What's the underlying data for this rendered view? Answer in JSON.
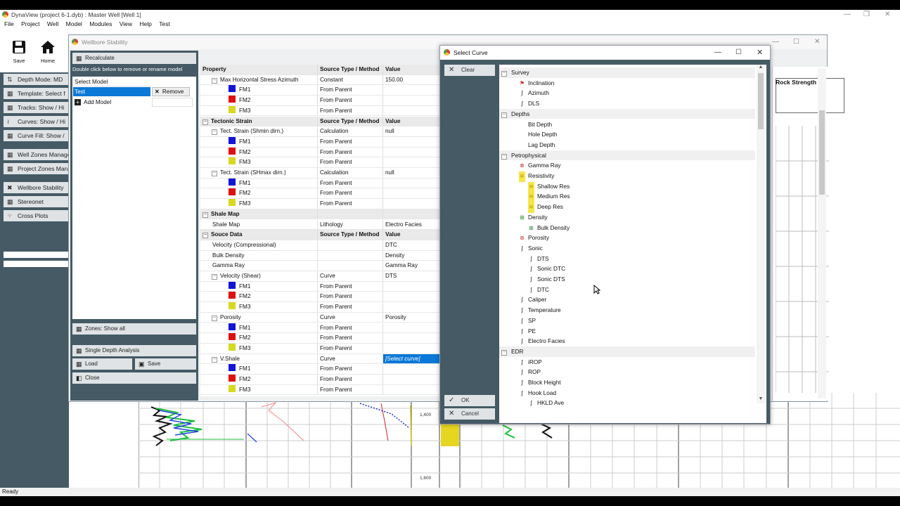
{
  "app": {
    "title": "DynaView (project 6-1.dyb) : Master Well [Well 1]",
    "menu": [
      "File",
      "Project",
      "Well",
      "Model",
      "Modules",
      "View",
      "Help",
      "Test"
    ],
    "toolbar": {
      "save_label": "Save",
      "home_label": "Home"
    },
    "status": "Ready"
  },
  "nav": {
    "items": [
      {
        "label": "Depth Mode: MD",
        "icon": "ruler-icon"
      },
      {
        "label": "Template: Select f",
        "icon": "grid-icon"
      },
      {
        "label": "Tracks: Show / Hi",
        "icon": "grid-icon"
      },
      {
        "label": "Curves: Show / Hi",
        "icon": "curves-icon"
      },
      {
        "label": "Curve Fill: Show /",
        "icon": "grid-icon"
      },
      {
        "label": "Well Zones Manage",
        "icon": "grid-icon"
      },
      {
        "label": "Project Zones Mana",
        "icon": "grid-icon"
      },
      {
        "label": "Wellbore Stability",
        "icon": "tool-icon"
      },
      {
        "label": "Stereonet",
        "icon": "grid-icon"
      },
      {
        "label": "Cross Plots",
        "icon": "dots-icon"
      }
    ]
  },
  "plot": {
    "depth1": "1,400",
    "depth2": "1,600",
    "right_header": "Rock Strength"
  },
  "wbs": {
    "title": "Wellbore Stability",
    "recalculate_label": "Recalculate",
    "hint": "Double click below to remove or rename model",
    "model_header": "Select Model",
    "model_selected": "Test",
    "remove_label": "Remove",
    "add_model_label": "Add Model",
    "zones_label": "Zones: Show all",
    "single_depth_label": "Single Depth Analysis",
    "load_label": "Load",
    "save_label": "Save",
    "close_label": "Close",
    "grid_header": {
      "c1": "Property",
      "c2": "Source Type / Method",
      "c3": "Value"
    },
    "rows": [
      {
        "type": "item",
        "lvl": 1,
        "exp": true,
        "c1": "Max Horizontal Stress Azimuth",
        "c2": "Constant",
        "c3": "150.00"
      },
      {
        "type": "fm",
        "c1": "FM1",
        "c2": "From Parent",
        "color": "#1414d8"
      },
      {
        "type": "fm",
        "c1": "FM2",
        "c2": "From Parent",
        "color": "#e01010"
      },
      {
        "type": "fm",
        "c1": "FM3",
        "c2": "From Parent",
        "color": "#d8d820"
      },
      {
        "type": "sec",
        "c1": "Tectonic Strain",
        "c2": "Source Type / Method",
        "c3": "Value"
      },
      {
        "type": "item",
        "lvl": 1,
        "exp": true,
        "c1": "Tect. Strain (Shmin dirn.)",
        "c2": "Calculation",
        "c3": "null"
      },
      {
        "type": "fm",
        "c1": "FM1",
        "c2": "From Parent",
        "color": "#1414d8"
      },
      {
        "type": "fm",
        "c1": "FM2",
        "c2": "From Parent",
        "color": "#e01010"
      },
      {
        "type": "fm",
        "c1": "FM3",
        "c2": "From Parent",
        "color": "#d8d820"
      },
      {
        "type": "item",
        "lvl": 1,
        "exp": true,
        "c1": "Tect. Strain (SHmax dirn.)",
        "c2": "Calculation",
        "c3": "null"
      },
      {
        "type": "fm",
        "c1": "FM1",
        "c2": "From Parent",
        "color": "#1414d8"
      },
      {
        "type": "fm",
        "c1": "FM2",
        "c2": "From Parent",
        "color": "#e01010"
      },
      {
        "type": "fm",
        "c1": "FM3",
        "c2": "From Parent",
        "color": "#d8d820"
      },
      {
        "type": "sec",
        "c1": "Shale Map",
        "c2": "",
        "c3": ""
      },
      {
        "type": "item",
        "lvl": 1,
        "exp": false,
        "c1": "Shale Map",
        "c2": "Lithology",
        "c3": "Electro Facies"
      },
      {
        "type": "sec",
        "c1": "Souce Data",
        "c2": "Source Type / Method",
        "c3": "Value"
      },
      {
        "type": "item",
        "lvl": 1,
        "exp": false,
        "c1": "Velocity (Compressional)",
        "c2": "",
        "c3": "DTC"
      },
      {
        "type": "item",
        "lvl": 1,
        "exp": false,
        "c1": "Bulk Density",
        "c2": "",
        "c3": "Density"
      },
      {
        "type": "item",
        "lvl": 1,
        "exp": false,
        "c1": "Gamma Ray",
        "c2": "",
        "c3": "Gamma Ray"
      },
      {
        "type": "item",
        "lvl": 1,
        "exp": true,
        "c1": "Velocity (Shear)",
        "c2": "Curve",
        "c3": "DTS"
      },
      {
        "type": "fm",
        "c1": "FM1",
        "c2": "From Parent",
        "color": "#1414d8"
      },
      {
        "type": "fm",
        "c1": "FM2",
        "c2": "From Parent",
        "color": "#e01010"
      },
      {
        "type": "fm",
        "c1": "FM3",
        "c2": "From Parent",
        "color": "#d8d820"
      },
      {
        "type": "item",
        "lvl": 1,
        "exp": true,
        "c1": "Porosity",
        "c2": "Curve",
        "c3": "Porosity"
      },
      {
        "type": "fm",
        "c1": "FM1",
        "c2": "From Parent",
        "color": "#1414d8"
      },
      {
        "type": "fm",
        "c1": "FM2",
        "c2": "From Parent",
        "color": "#e01010"
      },
      {
        "type": "fm",
        "c1": "FM3",
        "c2": "From Parent",
        "color": "#d8d820"
      },
      {
        "type": "item",
        "lvl": 1,
        "exp": true,
        "c1": "V.Shale",
        "c2": "Curve",
        "c3": "[Select curve]",
        "active": true
      },
      {
        "type": "fm",
        "c1": "FM1",
        "c2": "From Parent",
        "color": "#1414d8"
      },
      {
        "type": "fm",
        "c1": "FM2",
        "c2": "From Parent",
        "color": "#e01010"
      },
      {
        "type": "fm",
        "c1": "FM3",
        "c2": "From Parent",
        "color": "#d8d820"
      }
    ]
  },
  "select_curve": {
    "title": "Select Curve",
    "clear_label": "Clear",
    "ok_label": "OK",
    "cancel_label": "Cancel",
    "tree": [
      {
        "lvl": 0,
        "label": "Survey",
        "cat": true
      },
      {
        "lvl": 1,
        "label": "Inclination",
        "icon": "flag-icon"
      },
      {
        "lvl": 1,
        "label": "Azimuth",
        "icon": "curve-icon"
      },
      {
        "lvl": 1,
        "label": "DLS",
        "icon": "curve-icon"
      },
      {
        "lvl": 0,
        "label": "Depths",
        "cat": true
      },
      {
        "lvl": 1,
        "label": "Bit Depth",
        "icon": ""
      },
      {
        "lvl": 1,
        "label": "Hole Depth",
        "icon": ""
      },
      {
        "lvl": 1,
        "label": "Lag Depth",
        "icon": ""
      },
      {
        "lvl": 0,
        "label": "Petrophysical",
        "cat": true
      },
      {
        "lvl": 1,
        "label": "Gamma Ray",
        "icon": "gamma-icon"
      },
      {
        "lvl": 1,
        "label": "Resistivity",
        "icon": "resistivity-icon"
      },
      {
        "lvl": 2,
        "label": "Shallow Res",
        "icon": "resistivity-icon"
      },
      {
        "lvl": 2,
        "label": "Medium Res",
        "icon": "resistivity-icon"
      },
      {
        "lvl": 2,
        "label": "Deep Res",
        "icon": "resistivity-icon"
      },
      {
        "lvl": 1,
        "label": "Density",
        "icon": "density-icon"
      },
      {
        "lvl": 2,
        "label": "Bulk Density",
        "icon": "density-icon"
      },
      {
        "lvl": 1,
        "label": "Porosity",
        "icon": "porosity-icon"
      },
      {
        "lvl": 1,
        "label": "Sonic",
        "icon": "curve-icon"
      },
      {
        "lvl": 2,
        "label": "DTS",
        "icon": "curve-icon"
      },
      {
        "lvl": 2,
        "label": "Sonic DTC",
        "icon": "curve-icon"
      },
      {
        "lvl": 2,
        "label": "Sonic DTS",
        "icon": "curve-icon"
      },
      {
        "lvl": 2,
        "label": "DTC",
        "icon": "curve-icon"
      },
      {
        "lvl": 1,
        "label": "Caliper",
        "icon": "curve-icon"
      },
      {
        "lvl": 1,
        "label": "Temperature",
        "icon": "curve-icon"
      },
      {
        "lvl": 1,
        "label": "SP",
        "icon": "curve-icon"
      },
      {
        "lvl": 1,
        "label": "PE",
        "icon": "curve-icon"
      },
      {
        "lvl": 1,
        "label": "Electro Facies",
        "icon": "curve-icon"
      },
      {
        "lvl": 0,
        "label": "EDR",
        "cat": true
      },
      {
        "lvl": 1,
        "label": "iROP",
        "icon": "curve-icon"
      },
      {
        "lvl": 1,
        "label": "ROP",
        "icon": "curve-icon"
      },
      {
        "lvl": 1,
        "label": "Block Height",
        "icon": "curve-icon"
      },
      {
        "lvl": 1,
        "label": "Hook Load",
        "icon": "curve-icon"
      },
      {
        "lvl": 2,
        "label": "HKLD Ave",
        "icon": "curve-icon"
      }
    ]
  }
}
